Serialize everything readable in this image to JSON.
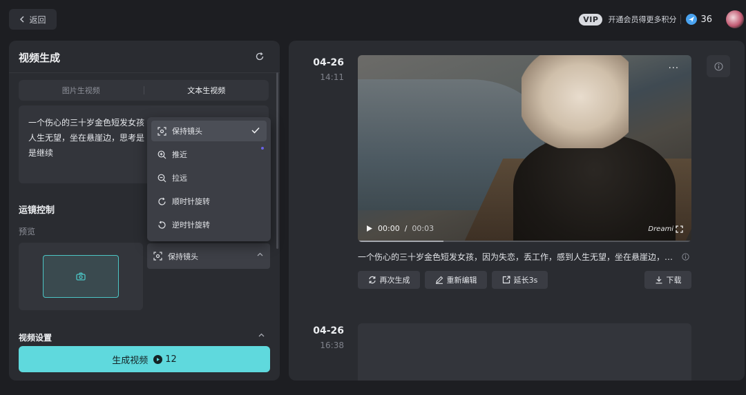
{
  "header": {
    "back_label": "返回",
    "vip_badge": "VIP",
    "vip_text": "开通会员得更多积分",
    "points": "36"
  },
  "left": {
    "title": "视频生成",
    "tabs": [
      {
        "label": "图片生视频",
        "active": false
      },
      {
        "label": "文本生视频",
        "active": true
      }
    ],
    "prompt_lines": [
      "一个伤心的三十岁金色短发女孩",
      "人生无望，坐在悬崖边，思考是",
      "是继续"
    ],
    "camera_section": "运镜控制",
    "preview_label": "预览",
    "camera_selected": "保持镜头",
    "settings_label": "视频设置",
    "generate_label": "生成视频",
    "generate_cost": "12"
  },
  "dropdown": {
    "items": [
      {
        "label": "保持镜头",
        "icon": "keep-camera-icon",
        "selected": true
      },
      {
        "label": "推近",
        "icon": "zoom-in-icon",
        "selected": false
      },
      {
        "label": "拉远",
        "icon": "zoom-out-icon",
        "selected": false
      },
      {
        "label": "顺时针旋转",
        "icon": "rotate-cw-icon",
        "selected": false
      },
      {
        "label": "逆时针旋转",
        "icon": "rotate-ccw-icon",
        "selected": false
      }
    ]
  },
  "results": [
    {
      "date": "04-26",
      "time": "14:11",
      "video_time_current": "00:00",
      "video_time_sep": "/",
      "video_time_total": "00:03",
      "watermark": "Dreami",
      "description": "一个伤心的三十岁金色短发女孩，因为失恋，丢工作，感到人生无望，坐在悬崖边，思...",
      "actions": [
        "再次生成",
        "重新编辑",
        "延长3s"
      ],
      "download": "下载"
    },
    {
      "date": "04-26",
      "time": "16:38"
    }
  ],
  "colors": {
    "accent": "#5fd9dd",
    "panel": "#2a2c31",
    "background": "#1d1e22"
  }
}
